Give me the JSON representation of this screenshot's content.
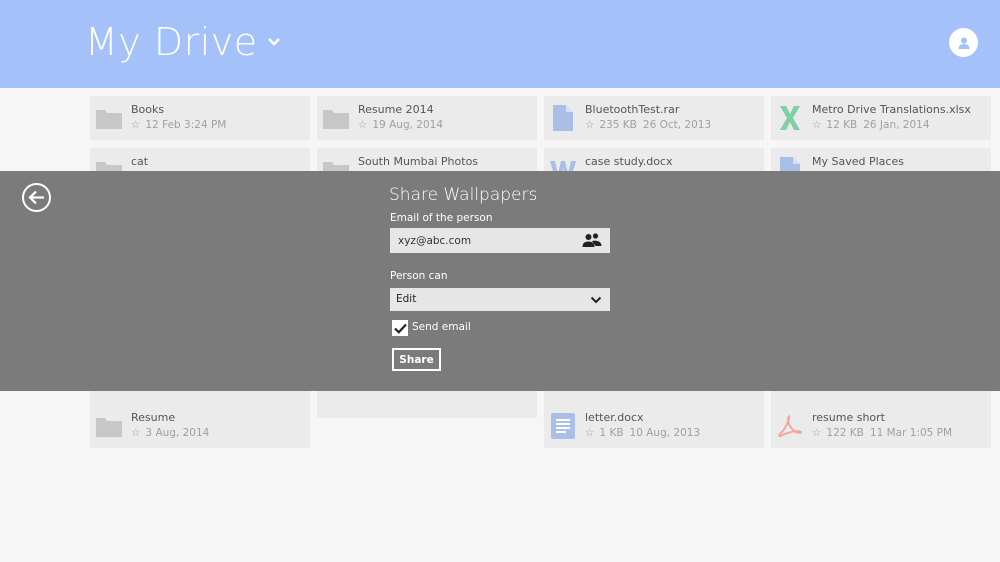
{
  "header": {
    "title": "My Drive"
  },
  "files": [
    {
      "name": "Books",
      "star": "☆",
      "size": "",
      "date": "12 Feb 3:24 PM",
      "icon": "folder-icon"
    },
    {
      "name": "Resume 2014",
      "star": "☆",
      "size": "",
      "date": "19 Aug, 2014",
      "icon": "folder-icon"
    },
    {
      "name": "BluetoothTest.rar",
      "star": "☆",
      "size": "235 KB",
      "date": "26 Oct, 2013",
      "icon": "document-icon"
    },
    {
      "name": "Metro Drive Translations.xlsx",
      "star": "☆",
      "size": "12 KB",
      "date": "26 Jan, 2014",
      "icon": "excel-icon"
    },
    {
      "name": "cat",
      "icon": "folder-icon"
    },
    {
      "name": "South Mumbai Photos",
      "icon": "folder-icon"
    },
    {
      "name": "case study.docx",
      "icon": "word-icon"
    },
    {
      "name": "My Saved Places",
      "icon": "document-icon"
    },
    {
      "name": "Resume",
      "star": "☆",
      "size": "",
      "date": "3 Aug, 2014",
      "icon": "folder-icon"
    },
    {
      "name": "letter.docx",
      "star": "☆",
      "size": "1 KB",
      "date": "10 Aug, 2013",
      "icon": "text-document-icon"
    },
    {
      "name": "resume short",
      "star": "☆",
      "size": "122 KB",
      "date": "11 Mar 1:05 PM",
      "icon": "pdf-icon"
    }
  ],
  "share_dialog": {
    "title": "Share Wallpapers",
    "email_label": "Email of the person",
    "email_value": "xyz@abc.com",
    "permission_label": "Person can",
    "permission_value": "Edit",
    "send_email_label": "Send email",
    "send_email_checked": true,
    "share_button": "Share"
  },
  "colors": {
    "header_bg": "#a4c2f9",
    "overlay_bg": "#7b7b7b",
    "tile_bg": "#ebebeb",
    "excel_green": "#7fd0a4",
    "doc_blue": "#a9bfe6",
    "pdf_red": "#f2a49a"
  }
}
